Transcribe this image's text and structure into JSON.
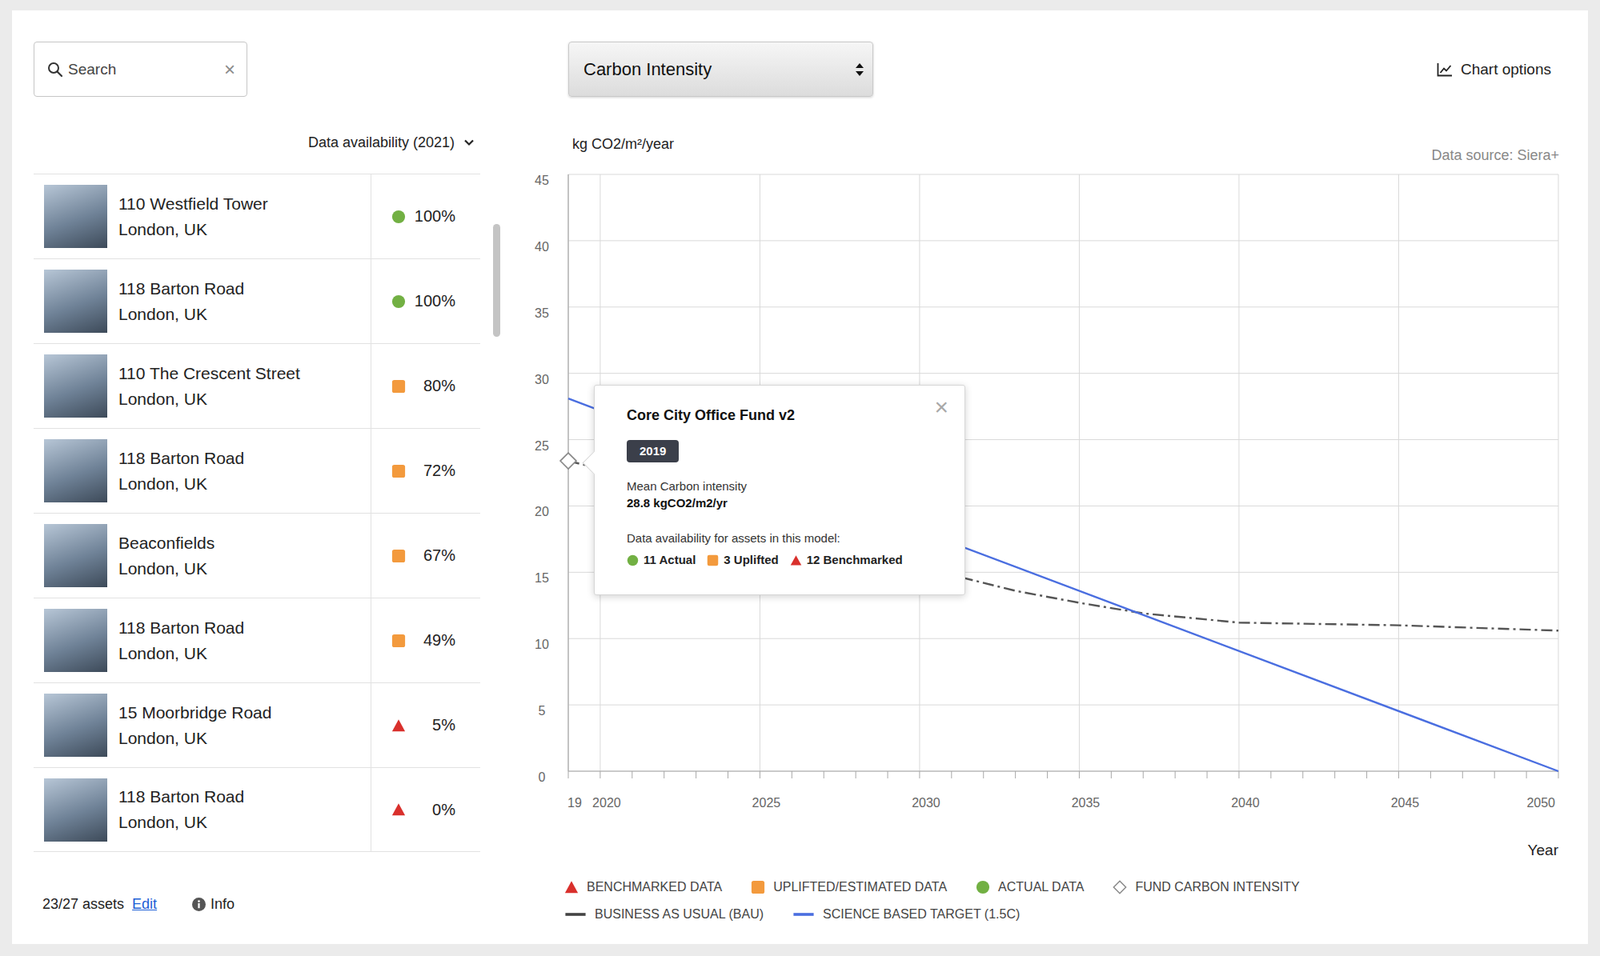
{
  "search": {
    "placeholder": "Search",
    "clear": "×"
  },
  "availability_filter": {
    "label": "Data availability (2021)",
    "expanded": false
  },
  "assets": [
    {
      "name": "110 Westfield Tower",
      "city": "London, UK",
      "availability": "100%",
      "kind": "dot",
      "color": "#72b043"
    },
    {
      "name": "118 Barton Road",
      "city": "London, UK",
      "availability": "100%",
      "kind": "dot",
      "color": "#72b043"
    },
    {
      "name": "110 The Crescent Street",
      "city": "London, UK",
      "availability": "80%",
      "kind": "square",
      "color": "#f39a3d"
    },
    {
      "name": "118 Barton Road",
      "city": "London, UK",
      "availability": "72%",
      "kind": "square",
      "color": "#f39a3d"
    },
    {
      "name": "Beaconfields",
      "city": "London, UK",
      "availability": "67%",
      "kind": "square",
      "color": "#f39a3d"
    },
    {
      "name": "118 Barton Road",
      "city": "London, UK",
      "availability": "49%",
      "kind": "square",
      "color": "#f39a3d"
    },
    {
      "name": "15 Moorbridge Road",
      "city": "London, UK",
      "availability": "5%",
      "kind": "triangle",
      "color": "#d9302c"
    },
    {
      "name": "118 Barton Road",
      "city": "London, UK",
      "availability": "0%",
      "kind": "triangle",
      "color": "#d9302c"
    }
  ],
  "footer": {
    "count": "23/27 assets",
    "edit": "Edit",
    "info": "Info"
  },
  "metric_select": {
    "value": "Carbon Intensity",
    "expanded": false
  },
  "chart_options": "Chart options",
  "chart": {
    "y_axis_label": "kg CO2/m²/year",
    "source": "Data source: Siera+",
    "x_title": "Year",
    "y_ticks": [
      {
        "label": "0",
        "value": 0
      },
      {
        "label": "5",
        "value": 5
      },
      {
        "label": "10",
        "value": 10
      },
      {
        "label": "15",
        "value": 15
      },
      {
        "label": "20",
        "value": 20
      },
      {
        "label": "25",
        "value": 25
      },
      {
        "label": "30",
        "value": 30
      },
      {
        "label": "35",
        "value": 35
      },
      {
        "label": "40",
        "value": 40
      },
      {
        "label": "45",
        "value": 45
      }
    ],
    "x_ticks": [
      {
        "label": "19",
        "year": 2019
      },
      {
        "label": "2020",
        "year": 2020
      },
      {
        "label": "2025",
        "year": 2025
      },
      {
        "label": "2030",
        "year": 2030
      },
      {
        "label": "2035",
        "year": 2035
      },
      {
        "label": "2040",
        "year": 2040
      },
      {
        "label": "2045",
        "year": 2045
      },
      {
        "label": "2050",
        "year": 2050
      }
    ],
    "series": [
      {
        "kind": "line",
        "style": "dash-dot",
        "color": "#555555",
        "years": [
          2019,
          2020,
          2025,
          2030,
          2033,
          2035,
          2037,
          2040,
          2045,
          2050
        ],
        "values": [
          23.4,
          22.8,
          19.0,
          15.4,
          13.6,
          12.7,
          11.9,
          11.2,
          11.0,
          10.6
        ]
      },
      {
        "kind": "line",
        "style": "solid",
        "color": "#4a6ee0",
        "years": [
          2019,
          2050
        ],
        "values": [
          28.1,
          0
        ]
      },
      {
        "kind": "diamond",
        "style": "point",
        "color": "#888888",
        "years": [
          2019
        ],
        "values": [
          23.4
        ]
      }
    ],
    "legend": [
      {
        "items": [
          {
            "label": "BENCHMARKED DATA",
            "kind": "triangle",
            "color": "#d9302c"
          },
          {
            "label": "UPLIFTED/ESTIMATED DATA",
            "kind": "square",
            "color": "#f39a3d"
          },
          {
            "label": "ACTUAL DATA",
            "kind": "dot",
            "color": "#72b043"
          },
          {
            "label": "FUND CARBON INTENSITY",
            "kind": "diamond",
            "color": "#888888"
          }
        ]
      },
      {
        "items": [
          {
            "label": "BUSINESS AS USUAL (BAU)",
            "kind": "line",
            "color": "#444444"
          },
          {
            "label": "SCIENCE BASED TARGET (1.5C)",
            "kind": "line",
            "color": "#4a6ee0"
          }
        ]
      }
    ],
    "tooltip": {
      "title": "Core City Office Fund v2",
      "close": "×",
      "year": "2019",
      "metric_label": "Mean Carbon intensity",
      "metric_value": "28.8 kgCO2/m2/yr",
      "availability_label": "Data availability for assets in this model:",
      "counts": [
        {
          "label": "11 Actual",
          "kind": "dot",
          "color": "#72b043"
        },
        {
          "label": "3 Uplifted",
          "kind": "square",
          "color": "#f39a3d"
        },
        {
          "label": "12 Benchmarked",
          "kind": "triangle",
          "color": "#d9302c"
        }
      ]
    }
  }
}
